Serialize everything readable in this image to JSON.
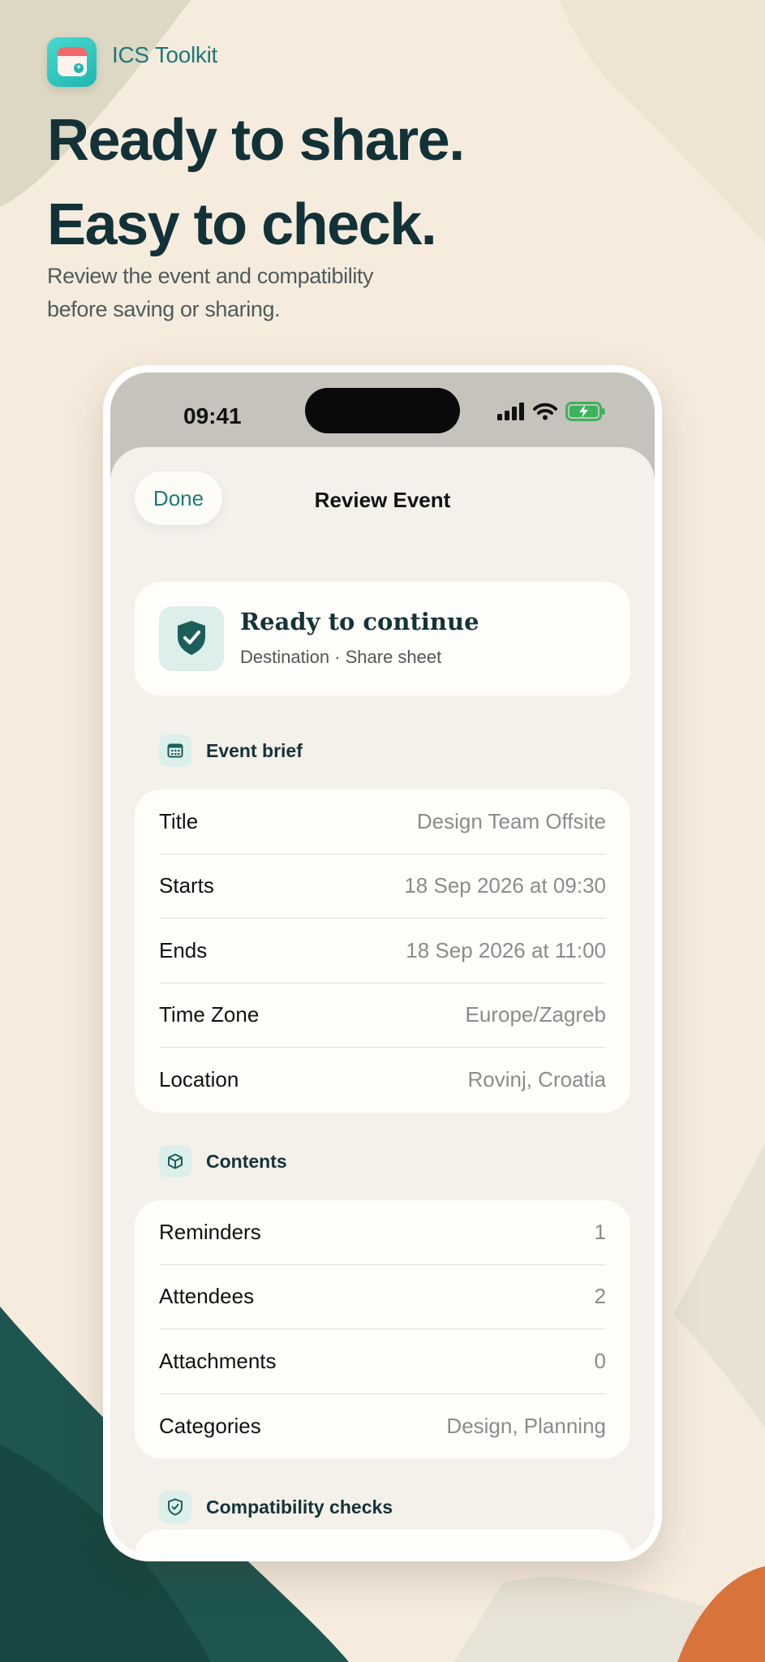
{
  "app": {
    "name": "ICS Toolkit"
  },
  "hero": {
    "headline_1": "Ready to share.",
    "headline_2": "Easy to check.",
    "subtitle": "Review the event and compatibility before saving or sharing."
  },
  "status_bar": {
    "time": "09:41"
  },
  "sheet": {
    "done_label": "Done",
    "title": "Review Event"
  },
  "ready_card": {
    "title": "Ready to continue",
    "subtitle": "Destination · Share sheet"
  },
  "event_brief": {
    "label": "Event brief",
    "rows": [
      {
        "key": "Title",
        "value": "Design Team Offsite"
      },
      {
        "key": "Starts",
        "value": "18 Sep 2026 at 09:30"
      },
      {
        "key": "Ends",
        "value": "18 Sep 2026 at 11:00"
      },
      {
        "key": "Time Zone",
        "value": "Europe/Zagreb"
      },
      {
        "key": "Location",
        "value": "Rovinj, Croatia"
      }
    ]
  },
  "contents": {
    "label": "Contents",
    "rows": [
      {
        "key": "Reminders",
        "value": "1"
      },
      {
        "key": "Attendees",
        "value": "2"
      },
      {
        "key": "Attachments",
        "value": "0"
      },
      {
        "key": "Categories",
        "value": "Design, Planning"
      }
    ]
  },
  "compatibility": {
    "label": "Compatibility checks"
  },
  "colors": {
    "accent": "#1f7a77",
    "headline": "#123238",
    "background": "#f6ecde"
  }
}
